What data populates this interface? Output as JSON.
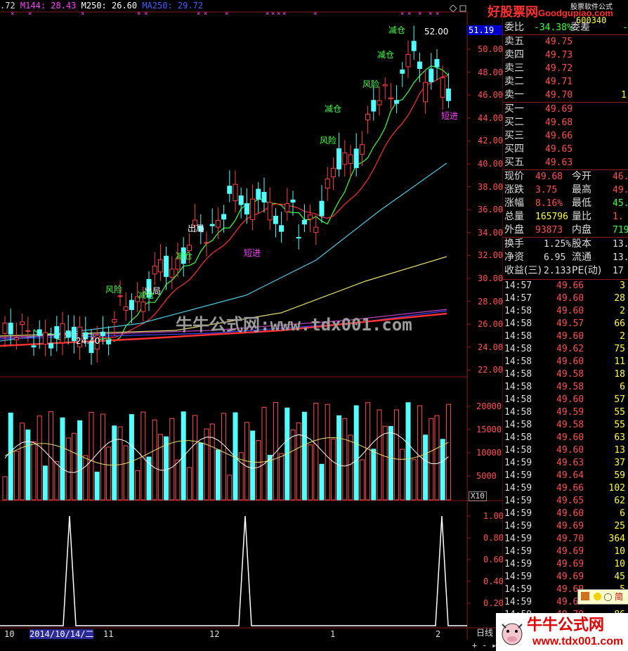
{
  "header": {
    "ma_prefix": ".72",
    "ma144": "M144: 28.43",
    "ma250a": "M250: 26.60",
    "ma250b": "MA250: 29.72",
    "ma144_color": "#ff40ff",
    "ma250_color": "#ffffff",
    "ma250b_color": "#4040ff"
  },
  "watermark_top": {
    "site": "好股票网",
    "domain": "Goodgupiao.com",
    "sub": "股票软件公式"
  },
  "stock_code": "600340",
  "current_price_tag": "51.19",
  "price_axis": [
    "50.00",
    "48.00",
    "46.00",
    "44.00",
    "42.00",
    "40.00",
    "38.00",
    "36.00",
    "34.00",
    "32.00",
    "30.00",
    "28.00",
    "26.00",
    "24.00",
    "22.00"
  ],
  "volume_axis": [
    "20000",
    "15000",
    "10000",
    "5000"
  ],
  "volume_unit": "X10",
  "signal_axis": [
    "1.00",
    "0.80",
    "0.60",
    "0.40",
    "0.20"
  ],
  "chart_annotations": [
    {
      "text": "减仓",
      "color": "#3dff3d"
    },
    {
      "text": "减仓",
      "color": "#3dff3d"
    },
    {
      "text": "风险",
      "color": "#3dff3d"
    },
    {
      "text": "减仓",
      "color": "#3dff3d"
    },
    {
      "text": "风险",
      "color": "#3dff3d"
    },
    {
      "text": "出局",
      "color": "#ffffff"
    },
    {
      "text": "减仓",
      "color": "#3dff3d"
    },
    {
      "text": "出局",
      "color": "#ffffff"
    },
    {
      "text": "风险",
      "color": "#3dff3d"
    },
    {
      "text": "减仓",
      "color": "#3dff3d"
    },
    {
      "text": "短进",
      "color": "#ff40ff"
    },
    {
      "text": "短进",
      "color": "#ff40ff"
    },
    {
      "text": "52.00",
      "color": "#ffffff"
    },
    {
      "text": "24.40",
      "color": "#ffffff"
    }
  ],
  "watermark_center": "牛牛公式网:www.tdx001.com",
  "date_axis": {
    "labels": [
      "10",
      "2014/10/14/二",
      "11",
      "12",
      "1",
      "2"
    ],
    "period": "日线"
  },
  "quote_panel": {
    "wei_bi_label": "委比",
    "wei_bi_value": "-34.38%",
    "wei_cha_label": "委差",
    "wei_cha_value": "-1",
    "sells": [
      {
        "label": "卖五",
        "price": "49.75",
        "vol": ""
      },
      {
        "label": "卖四",
        "price": "49.73",
        "vol": ""
      },
      {
        "label": "卖三",
        "price": "49.72",
        "vol": ""
      },
      {
        "label": "卖二",
        "price": "49.71",
        "vol": ""
      },
      {
        "label": "卖一",
        "price": "49.70",
        "vol": "1"
      }
    ],
    "buys": [
      {
        "label": "买一",
        "price": "49.69",
        "vol": ""
      },
      {
        "label": "买二",
        "price": "49.68",
        "vol": ""
      },
      {
        "label": "买三",
        "price": "49.66",
        "vol": ""
      },
      {
        "label": "买四",
        "price": "49.65",
        "vol": ""
      },
      {
        "label": "买五",
        "price": "49.63",
        "vol": ""
      }
    ],
    "stats": [
      {
        "l1": "现价",
        "v1": "49.68",
        "l2": "今开",
        "v2": "46.",
        "c1": "#ff5050",
        "c2": "#ff5050"
      },
      {
        "l1": "涨跌",
        "v1": "3.75",
        "l2": "最高",
        "v2": "49.",
        "c1": "#ff5050",
        "c2": "#ff5050"
      },
      {
        "l1": "涨幅",
        "v1": "8.16%",
        "l2": "最低",
        "v2": "45.",
        "c1": "#ff5050",
        "c2": "#3dff3d"
      },
      {
        "l1": "总量",
        "v1": "165796",
        "l2": "量比",
        "v2": "1.",
        "c1": "#ffff33",
        "c2": "#ff5050"
      },
      {
        "l1": "外盘",
        "v1": "93873",
        "l2": "内盘",
        "v2": "719",
        "c1": "#ff5050",
        "c2": "#3dff3d"
      }
    ],
    "fund": [
      {
        "l1": "换手",
        "v1": "1.25%",
        "l2": "股本",
        "v2": "13.2"
      },
      {
        "l1": "净资",
        "v1": "6.95",
        "l2": "流通",
        "v2": "13.2"
      },
      {
        "l1": "收益(三)",
        "v1": "2.133",
        "l2": "PE(动)",
        "v2": "17"
      }
    ]
  },
  "ticks": [
    {
      "t": "14:57",
      "p": "49.66",
      "v": "3",
      "pc": "#ff5050",
      "vc": "#ffff33"
    },
    {
      "t": "14:57",
      "p": "49.60",
      "v": "28",
      "pc": "#ff5050",
      "vc": "#ffff33"
    },
    {
      "t": "14:58",
      "p": "49.60",
      "v": "2",
      "pc": "#ff5050",
      "vc": "#ffff33"
    },
    {
      "t": "14:58",
      "p": "49.57",
      "v": "66",
      "pc": "#ff5050",
      "vc": "#ffff33"
    },
    {
      "t": "14:58",
      "p": "49.60",
      "v": "2",
      "pc": "#ff5050",
      "vc": "#ffff33"
    },
    {
      "t": "14:58",
      "p": "49.62",
      "v": "75",
      "pc": "#ff5050",
      "vc": "#ffff33"
    },
    {
      "t": "14:58",
      "p": "49.60",
      "v": "11",
      "pc": "#ff5050",
      "vc": "#ffff33"
    },
    {
      "t": "14:58",
      "p": "49.58",
      "v": "18",
      "pc": "#ff5050",
      "vc": "#ffff33"
    },
    {
      "t": "14:58",
      "p": "49.58",
      "v": "6",
      "pc": "#ff5050",
      "vc": "#ffff33"
    },
    {
      "t": "14:58",
      "p": "49.60",
      "v": "57",
      "pc": "#ff5050",
      "vc": "#ffff33"
    },
    {
      "t": "14:58",
      "p": "49.59",
      "v": "55",
      "pc": "#ff5050",
      "vc": "#ffff33"
    },
    {
      "t": "14:58",
      "p": "49.58",
      "v": "55",
      "pc": "#ff5050",
      "vc": "#ffff33"
    },
    {
      "t": "14:58",
      "p": "49.60",
      "v": "63",
      "pc": "#ff5050",
      "vc": "#ffff33"
    },
    {
      "t": "14:58",
      "p": "49.60",
      "v": "13",
      "pc": "#ff5050",
      "vc": "#ffff33"
    },
    {
      "t": "14:59",
      "p": "49.63",
      "v": "37",
      "pc": "#ff5050",
      "vc": "#ffff33"
    },
    {
      "t": "14:59",
      "p": "49.64",
      "v": "59",
      "pc": "#ff5050",
      "vc": "#ffff33"
    },
    {
      "t": "14:59",
      "p": "49.66",
      "v": "102",
      "pc": "#ff5050",
      "vc": "#ffff33"
    },
    {
      "t": "14:59",
      "p": "49.65",
      "v": "62",
      "pc": "#ff5050",
      "vc": "#ffff33"
    },
    {
      "t": "14:59",
      "p": "49.60",
      "v": "6",
      "pc": "#ff5050",
      "vc": "#ffff33"
    },
    {
      "t": "14:59",
      "p": "49.69",
      "v": "25",
      "pc": "#ff5050",
      "vc": "#ffff33"
    },
    {
      "t": "14:59",
      "p": "49.70",
      "v": "364",
      "pc": "#ff5050",
      "vc": "#ffff33"
    },
    {
      "t": "14:59",
      "p": "49.69",
      "v": "10",
      "pc": "#ff5050",
      "vc": "#ffff33"
    },
    {
      "t": "14:59",
      "p": "49.69",
      "v": "10",
      "pc": "#ff5050",
      "vc": "#ffff33"
    },
    {
      "t": "14:59",
      "p": "49.69",
      "v": "45",
      "pc": "#ff5050",
      "vc": "#ffff33"
    },
    {
      "t": "14:59",
      "p": "49.69",
      "v": "5",
      "pc": "#ff5050",
      "vc": "#ffff33"
    },
    {
      "t": "14:59",
      "p": "49.69",
      "v": "2",
      "pc": "#ff5050",
      "vc": "#ffff33"
    },
    {
      "t": "14:59",
      "p": "49.70",
      "v": "86",
      "pc": "#ff5050",
      "vc": "#ffff33"
    }
  ],
  "bottom_watermark": {
    "title": "牛牛公式网",
    "url": "www.tdx001.com"
  },
  "mini_widget": {
    "label": "简"
  }
}
